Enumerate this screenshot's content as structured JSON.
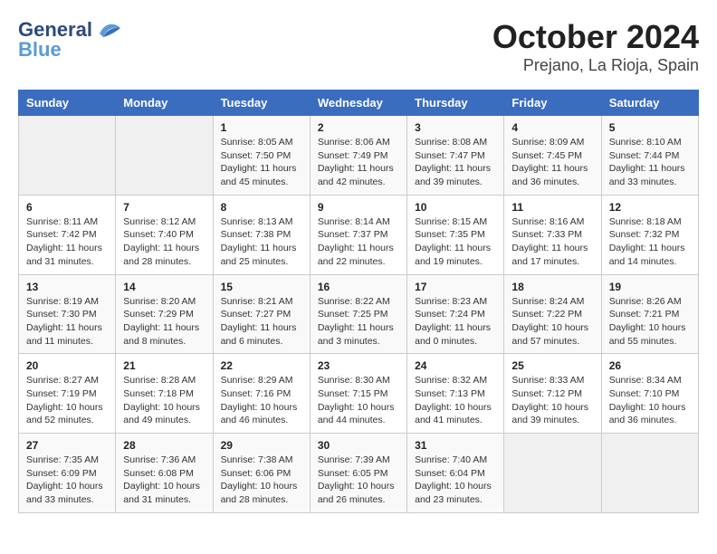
{
  "logo": {
    "line1": "General",
    "line2": "Blue"
  },
  "title": "October 2024",
  "subtitle": "Prejano, La Rioja, Spain",
  "weekdays": [
    "Sunday",
    "Monday",
    "Tuesday",
    "Wednesday",
    "Thursday",
    "Friday",
    "Saturday"
  ],
  "weeks": [
    [
      {
        "day": "",
        "info": ""
      },
      {
        "day": "",
        "info": ""
      },
      {
        "day": "1",
        "info": "Sunrise: 8:05 AM\nSunset: 7:50 PM\nDaylight: 11 hours and 45 minutes."
      },
      {
        "day": "2",
        "info": "Sunrise: 8:06 AM\nSunset: 7:49 PM\nDaylight: 11 hours and 42 minutes."
      },
      {
        "day": "3",
        "info": "Sunrise: 8:08 AM\nSunset: 7:47 PM\nDaylight: 11 hours and 39 minutes."
      },
      {
        "day": "4",
        "info": "Sunrise: 8:09 AM\nSunset: 7:45 PM\nDaylight: 11 hours and 36 minutes."
      },
      {
        "day": "5",
        "info": "Sunrise: 8:10 AM\nSunset: 7:44 PM\nDaylight: 11 hours and 33 minutes."
      }
    ],
    [
      {
        "day": "6",
        "info": "Sunrise: 8:11 AM\nSunset: 7:42 PM\nDaylight: 11 hours and 31 minutes."
      },
      {
        "day": "7",
        "info": "Sunrise: 8:12 AM\nSunset: 7:40 PM\nDaylight: 11 hours and 28 minutes."
      },
      {
        "day": "8",
        "info": "Sunrise: 8:13 AM\nSunset: 7:38 PM\nDaylight: 11 hours and 25 minutes."
      },
      {
        "day": "9",
        "info": "Sunrise: 8:14 AM\nSunset: 7:37 PM\nDaylight: 11 hours and 22 minutes."
      },
      {
        "day": "10",
        "info": "Sunrise: 8:15 AM\nSunset: 7:35 PM\nDaylight: 11 hours and 19 minutes."
      },
      {
        "day": "11",
        "info": "Sunrise: 8:16 AM\nSunset: 7:33 PM\nDaylight: 11 hours and 17 minutes."
      },
      {
        "day": "12",
        "info": "Sunrise: 8:18 AM\nSunset: 7:32 PM\nDaylight: 11 hours and 14 minutes."
      }
    ],
    [
      {
        "day": "13",
        "info": "Sunrise: 8:19 AM\nSunset: 7:30 PM\nDaylight: 11 hours and 11 minutes."
      },
      {
        "day": "14",
        "info": "Sunrise: 8:20 AM\nSunset: 7:29 PM\nDaylight: 11 hours and 8 minutes."
      },
      {
        "day": "15",
        "info": "Sunrise: 8:21 AM\nSunset: 7:27 PM\nDaylight: 11 hours and 6 minutes."
      },
      {
        "day": "16",
        "info": "Sunrise: 8:22 AM\nSunset: 7:25 PM\nDaylight: 11 hours and 3 minutes."
      },
      {
        "day": "17",
        "info": "Sunrise: 8:23 AM\nSunset: 7:24 PM\nDaylight: 11 hours and 0 minutes."
      },
      {
        "day": "18",
        "info": "Sunrise: 8:24 AM\nSunset: 7:22 PM\nDaylight: 10 hours and 57 minutes."
      },
      {
        "day": "19",
        "info": "Sunrise: 8:26 AM\nSunset: 7:21 PM\nDaylight: 10 hours and 55 minutes."
      }
    ],
    [
      {
        "day": "20",
        "info": "Sunrise: 8:27 AM\nSunset: 7:19 PM\nDaylight: 10 hours and 52 minutes."
      },
      {
        "day": "21",
        "info": "Sunrise: 8:28 AM\nSunset: 7:18 PM\nDaylight: 10 hours and 49 minutes."
      },
      {
        "day": "22",
        "info": "Sunrise: 8:29 AM\nSunset: 7:16 PM\nDaylight: 10 hours and 46 minutes."
      },
      {
        "day": "23",
        "info": "Sunrise: 8:30 AM\nSunset: 7:15 PM\nDaylight: 10 hours and 44 minutes."
      },
      {
        "day": "24",
        "info": "Sunrise: 8:32 AM\nSunset: 7:13 PM\nDaylight: 10 hours and 41 minutes."
      },
      {
        "day": "25",
        "info": "Sunrise: 8:33 AM\nSunset: 7:12 PM\nDaylight: 10 hours and 39 minutes."
      },
      {
        "day": "26",
        "info": "Sunrise: 8:34 AM\nSunset: 7:10 PM\nDaylight: 10 hours and 36 minutes."
      }
    ],
    [
      {
        "day": "27",
        "info": "Sunrise: 7:35 AM\nSunset: 6:09 PM\nDaylight: 10 hours and 33 minutes."
      },
      {
        "day": "28",
        "info": "Sunrise: 7:36 AM\nSunset: 6:08 PM\nDaylight: 10 hours and 31 minutes."
      },
      {
        "day": "29",
        "info": "Sunrise: 7:38 AM\nSunset: 6:06 PM\nDaylight: 10 hours and 28 minutes."
      },
      {
        "day": "30",
        "info": "Sunrise: 7:39 AM\nSunset: 6:05 PM\nDaylight: 10 hours and 26 minutes."
      },
      {
        "day": "31",
        "info": "Sunrise: 7:40 AM\nSunset: 6:04 PM\nDaylight: 10 hours and 23 minutes."
      },
      {
        "day": "",
        "info": ""
      },
      {
        "day": "",
        "info": ""
      }
    ]
  ]
}
